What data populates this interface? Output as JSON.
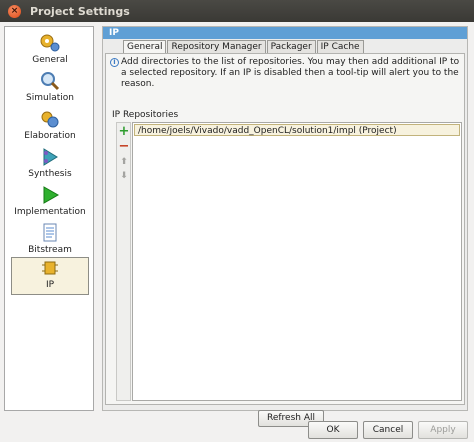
{
  "window": {
    "title": "Project Settings"
  },
  "sidebar": {
    "items": [
      {
        "label": "General",
        "icon": "general-icon"
      },
      {
        "label": "Simulation",
        "icon": "simulation-icon"
      },
      {
        "label": "Elaboration",
        "icon": "elaboration-icon"
      },
      {
        "label": "Synthesis",
        "icon": "synthesis-icon"
      },
      {
        "label": "Implementation",
        "icon": "implementation-icon"
      },
      {
        "label": "Bitstream",
        "icon": "bitstream-icon"
      },
      {
        "label": "IP",
        "icon": "ip-icon",
        "selected": true
      }
    ]
  },
  "panel": {
    "header": "IP",
    "tabs": [
      {
        "label": "General",
        "active": true
      },
      {
        "label": "Repository Manager",
        "active": false
      },
      {
        "label": "Packager",
        "active": false
      },
      {
        "label": "IP Cache",
        "active": false
      }
    ],
    "info_text": "Add directories to the list of repositories. You may then add additional IP to a selected repository. If an IP is disabled then a tool-tip will alert you to the reason.",
    "section_label": "IP Repositories",
    "repositories": [
      "/home/joels/Vivado/vadd_OpenCL/solution1/impl (Project)"
    ],
    "refresh_label": "Refresh All"
  },
  "footer": {
    "ok_label": "OK",
    "cancel_label": "Cancel",
    "apply_label": "Apply"
  },
  "colors": {
    "header": "#5f9fd5",
    "selection": "#f7f2de",
    "add": "#2e9d2e",
    "remove": "#c43b1d"
  }
}
